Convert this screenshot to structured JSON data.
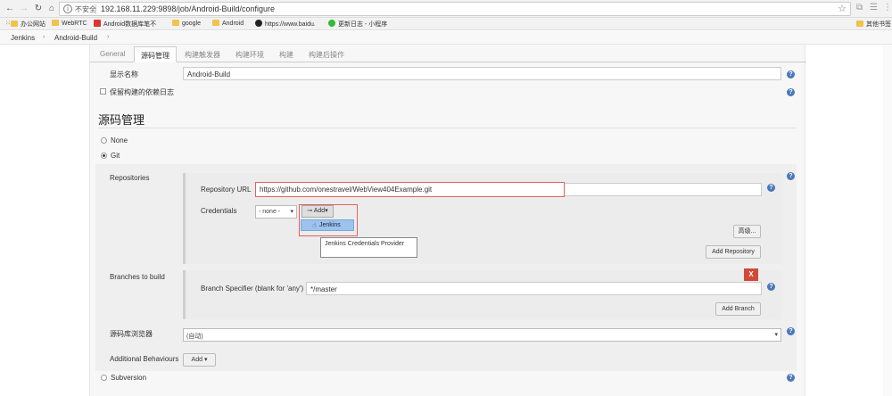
{
  "browser": {
    "insecure_label": "不安全",
    "url": "192.168.11.229:9898/job/Android-Build/configure",
    "bookmarks": [
      {
        "label": "办公网站",
        "icon": "folder-icon"
      },
      {
        "label": "WebRTC",
        "icon": "folder-icon"
      },
      {
        "label": "Android数据库笔不",
        "icon": "red-app-icon"
      },
      {
        "label": "google",
        "icon": "folder-icon"
      },
      {
        "label": "Android",
        "icon": "folder-icon"
      },
      {
        "label": "https://www.baidu.",
        "icon": "github-icon"
      },
      {
        "label": "更新日志 - 小程序",
        "icon": "wechat-icon"
      }
    ],
    "other_bookmarks": "其他书签"
  },
  "breadcrumb": {
    "items": [
      "Jenkins",
      "Android-Build"
    ]
  },
  "tabs": [
    "General",
    "源码管理",
    "构建触发器",
    "构建环境",
    "构建",
    "构建后操作"
  ],
  "general": {
    "display_name_label": "显示名称",
    "display_name_value": "Android-Build",
    "keep_logs_label": "保留构建的依赖日志"
  },
  "scm": {
    "title": "源码管理",
    "options": [
      "None",
      "Git",
      "Subversion"
    ],
    "selected": "Git",
    "repositories_label": "Repositories",
    "repo_url_label": "Repository URL",
    "repo_url_value": "https://github.com/onestravel/WebView404Example.git",
    "credentials_label": "Credentials",
    "credentials_value": "- none -",
    "add_label": "Add",
    "menu_item": "Jenkins",
    "tooltip": "Jenkins Credentials Provider",
    "advanced_button": "高级...",
    "add_repository_button": "Add Repository",
    "branches_label": "Branches to build",
    "branch_specifier_label": "Branch Specifier (blank for 'any')",
    "branch_specifier_value": "*/master",
    "delete_label": "X",
    "add_branch_button": "Add Branch",
    "browser_label": "源码库浏览器",
    "browser_value": "(自动)",
    "behaviours_label": "Additional Behaviours",
    "behaviours_add": "Add"
  }
}
